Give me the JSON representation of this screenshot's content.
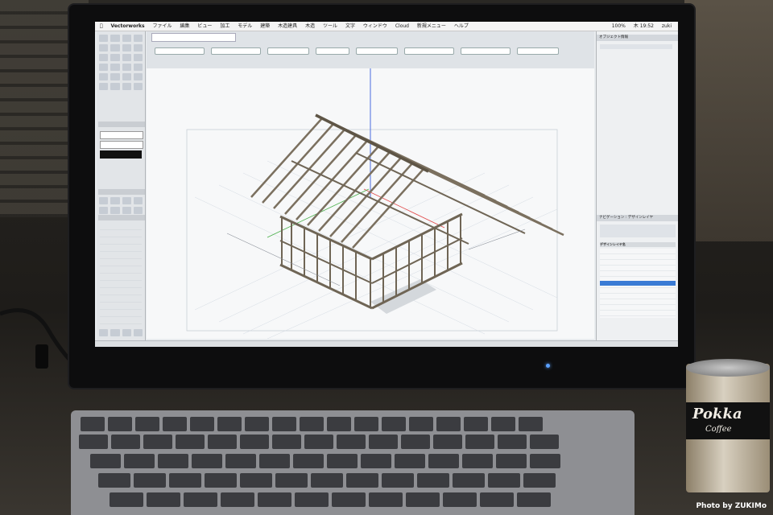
{
  "photo_credit": "Photo by ZUKIMo",
  "app": {
    "name": "Vectorworks",
    "menus": [
      "ファイル",
      "編集",
      "ビュー",
      "加工",
      "モデル",
      "建築",
      "木造建具",
      "木造",
      "ツール",
      "文字",
      "ウィンドウ",
      "Cloud",
      "新規メニュー",
      "ヘルプ"
    ],
    "status_right": {
      "battery": "100%",
      "time": "木 19:52",
      "user": "zuki"
    }
  },
  "right_panel": {
    "obj_info_title": "オブジェクト情報",
    "nav_title": "ナビゲーション : デザインレイヤ",
    "layer_list_header": "デザインレイヤ名"
  },
  "can": {
    "brand": "Pokka",
    "sub": "Coffee"
  },
  "colors": {
    "screen_bg": "#e9ecef",
    "frame_wood": "#8a7f6e",
    "bezel": "#0d0d0e"
  }
}
